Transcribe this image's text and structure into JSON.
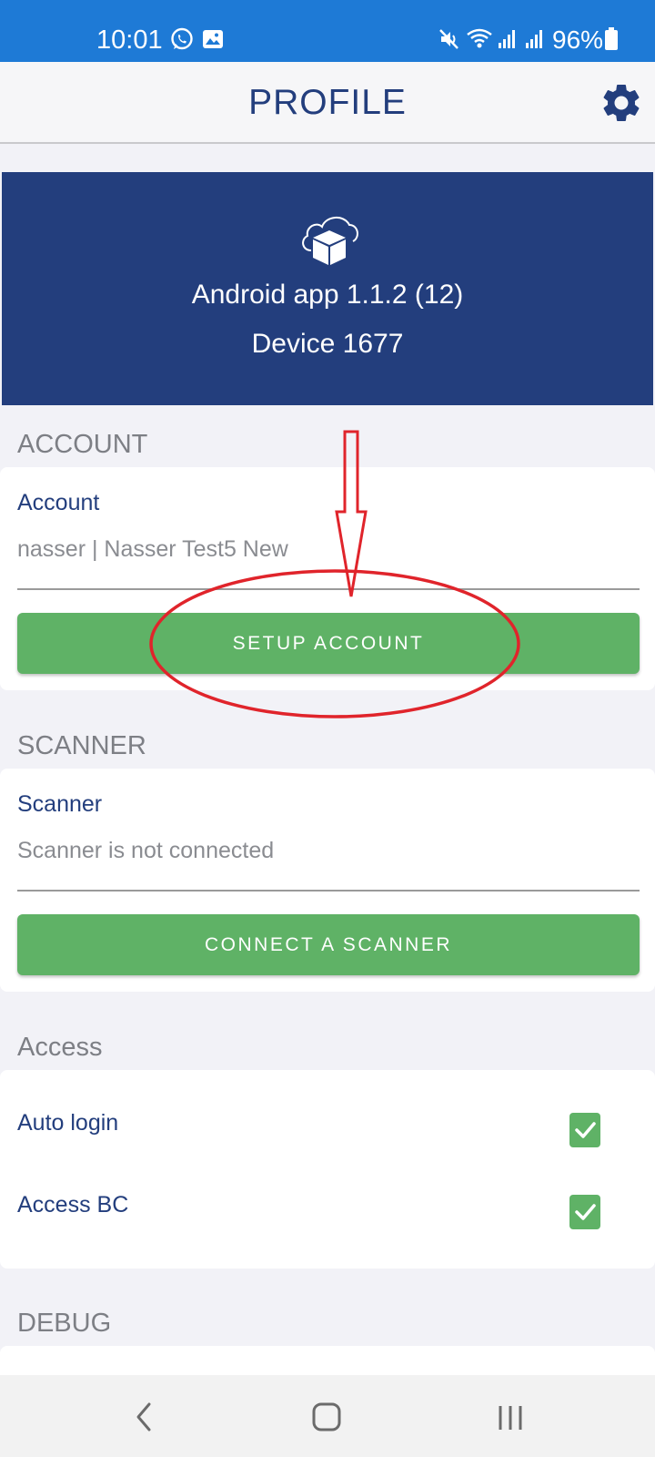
{
  "status_bar": {
    "time": "10:01",
    "battery": "96%",
    "color": "#1e7ad6"
  },
  "header": {
    "title": "PROFILE",
    "settings_icon": "gear-icon"
  },
  "banner": {
    "app_version": "Android app 1.1.2 (12)",
    "device": "Device 1677",
    "logo_icon": "cloud-box-icon",
    "color": "#233e7d"
  },
  "account": {
    "section_title": "ACCOUNT",
    "field_label": "Account",
    "field_value": "nasser | Nasser Test5 New",
    "button_label": "SETUP ACCOUNT"
  },
  "scanner": {
    "section_title": "SCANNER",
    "field_label": "Scanner",
    "field_value": "Scanner is not connected",
    "button_label": "CONNECT A SCANNER"
  },
  "access": {
    "section_title": "Access",
    "items": [
      {
        "label": "Auto login",
        "checked": true
      },
      {
        "label": "Access BC",
        "checked": true
      }
    ]
  },
  "debug": {
    "section_title": "DEBUG"
  },
  "colors": {
    "accent_green": "#5fb266",
    "annotation_red": "#e0242b"
  }
}
